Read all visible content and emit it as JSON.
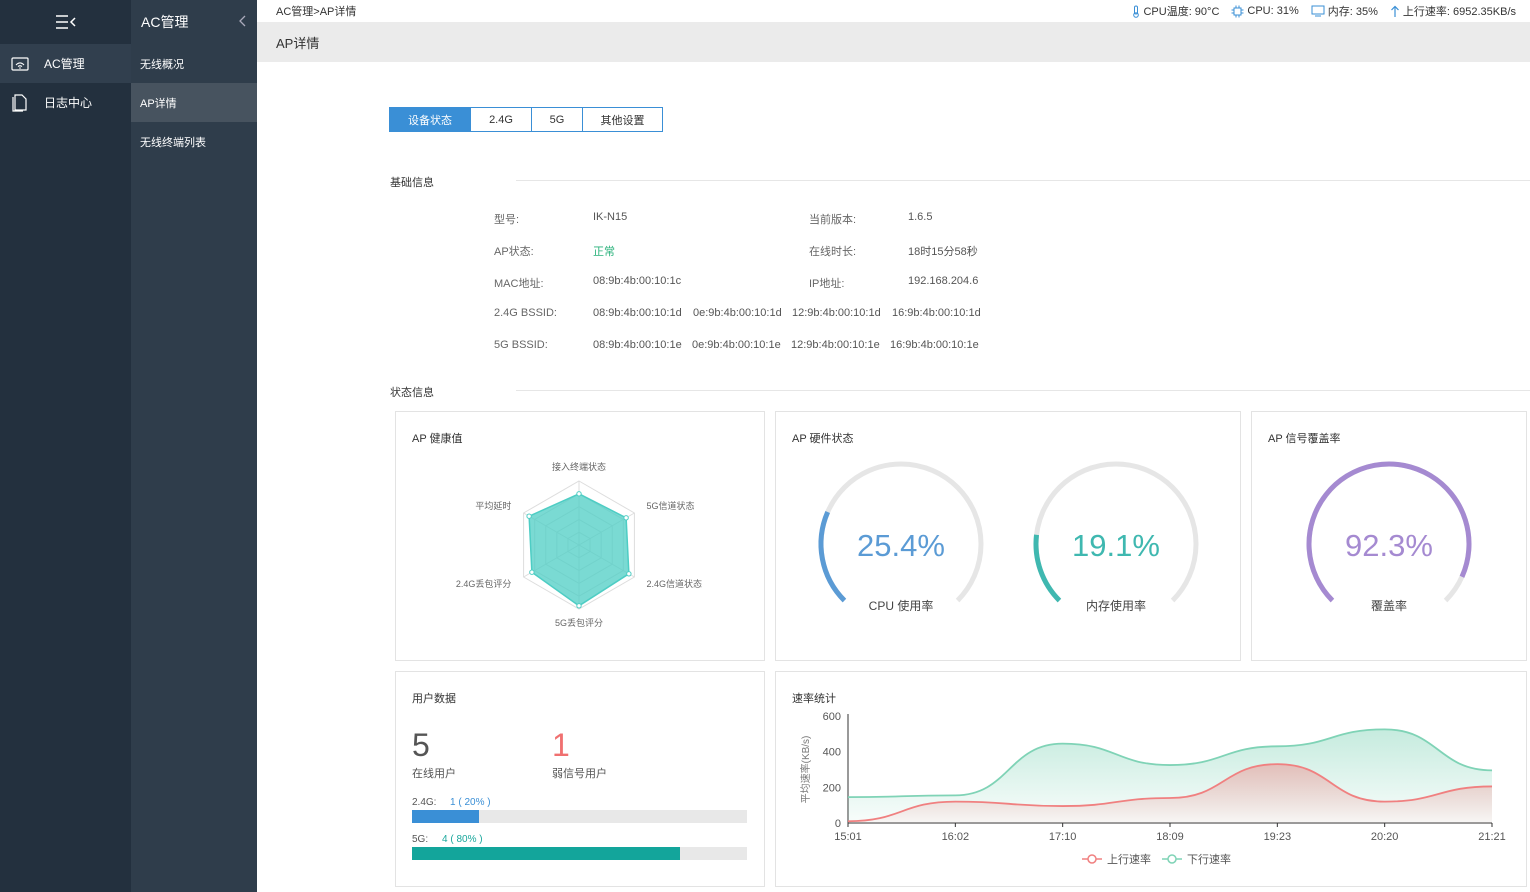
{
  "sidebar": {
    "items": [
      {
        "label": "AC管理",
        "icon": "wifi-router-icon"
      },
      {
        "label": "日志中心",
        "icon": "document-icon"
      }
    ]
  },
  "submenu": {
    "title": "AC管理",
    "items": [
      {
        "label": "无线概况"
      },
      {
        "label": "AP详情"
      },
      {
        "label": "无线终端列表"
      }
    ]
  },
  "topbar": {
    "breadcrumb": "AC管理>AP详情",
    "cpu_temp": "CPU温度: 90°C",
    "cpu": "CPU: 31%",
    "memory": "内存: 35%",
    "upload": "上行速率: 6952.35KB/s"
  },
  "page": {
    "title": "AP详情"
  },
  "tabs": [
    {
      "label": "设备状态"
    },
    {
      "label": "2.4G"
    },
    {
      "label": "5G"
    },
    {
      "label": "其他设置"
    }
  ],
  "basic": {
    "title": "基础信息",
    "model_label": "型号:",
    "model": "IK-N15",
    "version_label": "当前版本:",
    "version": "1.6.5",
    "status_label": "AP状态:",
    "status": "正常",
    "uptime_label": "在线时长:",
    "uptime": "18时15分58秒",
    "mac_label": "MAC地址:",
    "mac": "08:9b:4b:00:10:1c",
    "ip_label": "IP地址:",
    "ip": "192.168.204.6",
    "bssid24_label": "2.4G BSSID:",
    "bssid24": [
      "08:9b:4b:00:10:1d",
      "0e:9b:4b:00:10:1d",
      "12:9b:4b:00:10:1d",
      "16:9b:4b:00:10:1d"
    ],
    "bssid5_label": "5G BSSID:",
    "bssid5": [
      "08:9b:4b:00:10:1e",
      "0e:9b:4b:00:10:1e",
      "12:9b:4b:00:10:1e",
      "16:9b:4b:00:10:1e"
    ]
  },
  "status": {
    "title": "状态信息"
  },
  "health": {
    "title": "AP 健康值",
    "axes": [
      "接入终端状态",
      "5G信道状态",
      "2.4G信道状态",
      "5G丢包评分",
      "2.4G丢包评分",
      "平均延时"
    ],
    "values": [
      0.8,
      0.85,
      0.9,
      0.95,
      0.85,
      0.9
    ],
    "color": "#4ecdc4"
  },
  "hardware": {
    "title": "AP 硬件状态",
    "cpu_value": "25.4%",
    "cpu_label": "CPU 使用率",
    "cpu_frac": 0.254,
    "cpu_color": "#5b9bd5",
    "mem_value": "19.1%",
    "mem_label": "内存使用率",
    "mem_frac": 0.191,
    "mem_color": "#3fb8b0"
  },
  "coverage": {
    "title": "AP 信号覆盖率",
    "value": "92.3%",
    "label": "覆盖率",
    "frac": 0.923,
    "color": "#a58ad1"
  },
  "users": {
    "title": "用户数据",
    "online": "5",
    "online_label": "在线用户",
    "weak": "1",
    "weak_label": "弱信号用户",
    "band24_label": "2.4G:",
    "band24_value": "1 ( 20% )",
    "band24_frac": 0.2,
    "band5_label": "5G:",
    "band5_value": "4 ( 80% )",
    "band5_frac": 0.8
  },
  "chart_data": {
    "type": "area",
    "title": "速率统计",
    "ylabel": "平均速率(KB/s)",
    "xlabel": "",
    "ylim": [
      0,
      600
    ],
    "yticks": [
      "0",
      "200",
      "400",
      "600"
    ],
    "x": [
      "15:01",
      "16:02",
      "17:10",
      "18:09",
      "19:23",
      "20:20",
      "21:21"
    ],
    "series": [
      {
        "name": "上行速率",
        "color": "#f08080",
        "values": [
          10,
          120,
          95,
          140,
          330,
          120,
          205
        ]
      },
      {
        "name": "下行速率",
        "color": "#7fd3b6",
        "values": [
          145,
          155,
          445,
          325,
          430,
          525,
          295
        ]
      }
    ],
    "legend": "bottom"
  }
}
